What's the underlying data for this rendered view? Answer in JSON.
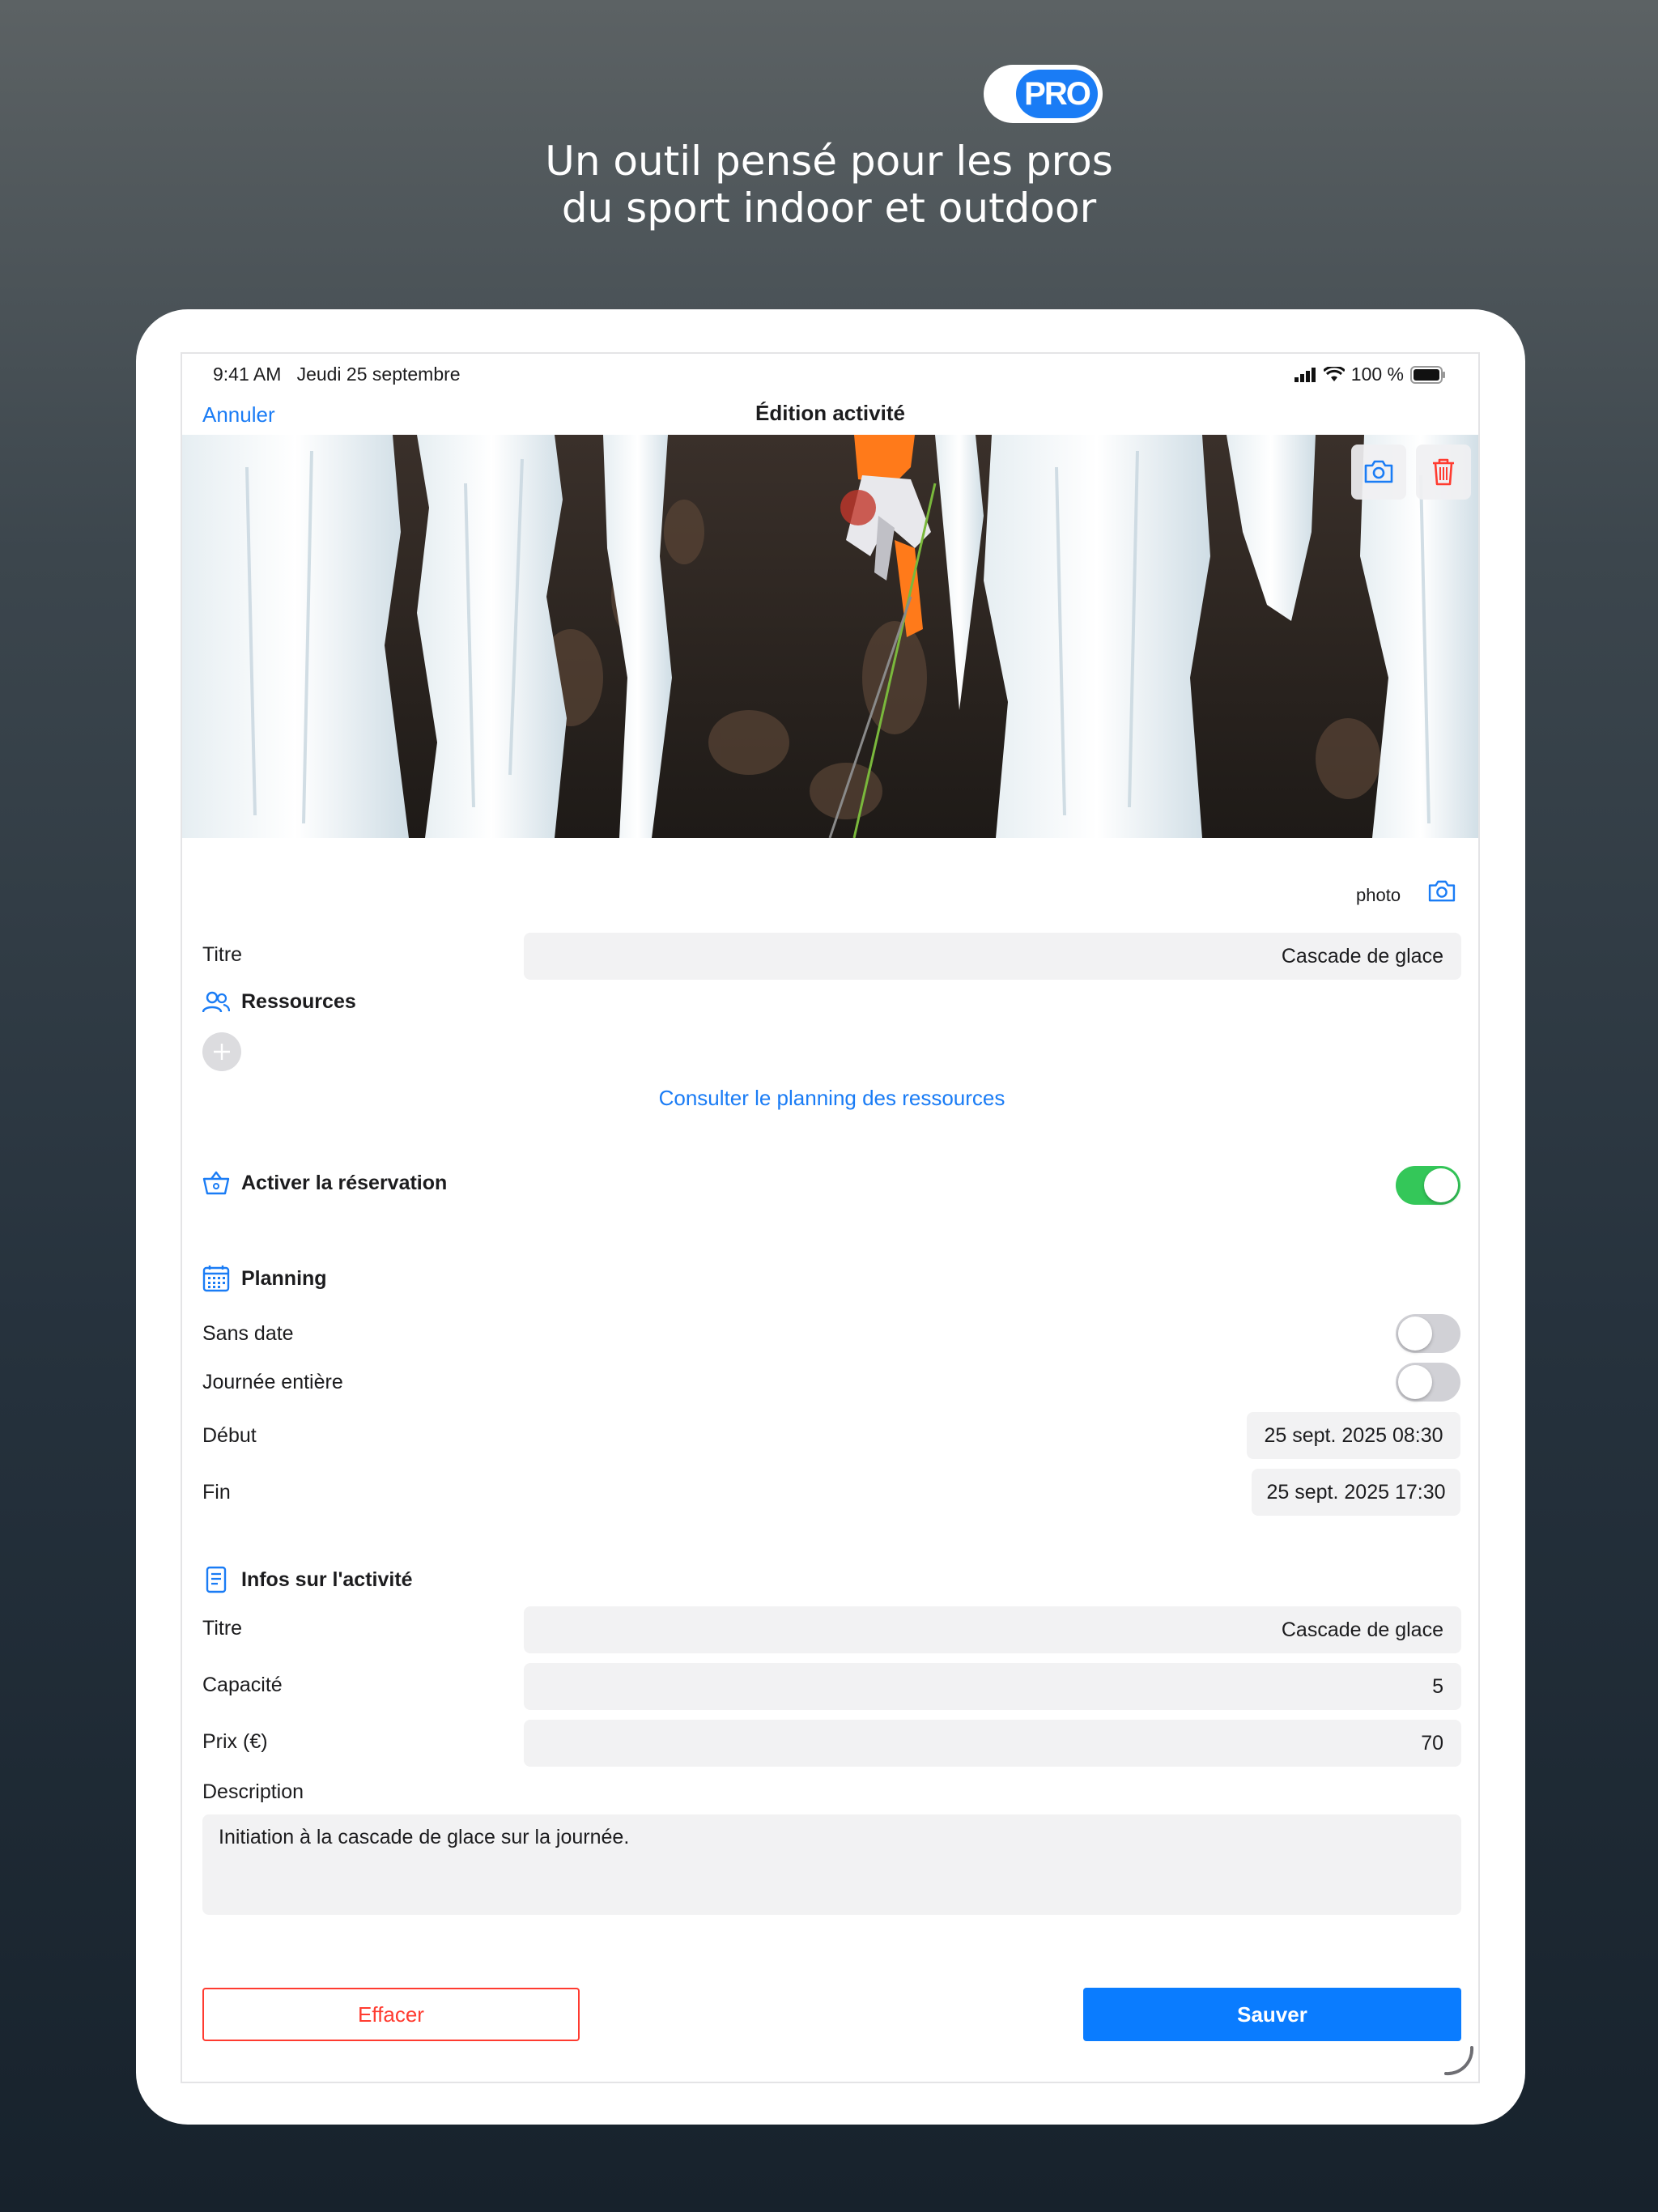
{
  "promo": {
    "badge": "PRO",
    "headline_1": "Un outil pensé pour les pros",
    "headline_2": "du sport indoor et outdoor"
  },
  "status": {
    "time": "9:41 AM",
    "date": "Jeudi 25 septembre",
    "battery": "100 %"
  },
  "nav": {
    "cancel": "Annuler",
    "title": "Édition activité"
  },
  "photo": {
    "label": "photo"
  },
  "form": {
    "titre_label": "Titre",
    "titre_value": "Cascade de glace",
    "ressources_heading": "Ressources",
    "planning_link": "Consulter le planning des ressources",
    "reservation_label": "Activer la réservation",
    "reservation_on": true
  },
  "planning": {
    "heading": "Planning",
    "sans_date_label": "Sans date",
    "journee_label": "Journée entière",
    "debut_label": "Début",
    "debut_value": "25 sept. 2025 08:30",
    "fin_label": "Fin",
    "fin_value": "25 sept. 2025 17:30"
  },
  "infos": {
    "heading": "Infos sur l'activité",
    "titre_label": "Titre",
    "titre_value": "Cascade de glace",
    "capacite_label": "Capacité",
    "capacite_value": "5",
    "prix_label": "Prix (€)",
    "prix_value": "70",
    "description_label": "Description",
    "description_value": "Initiation à la cascade de glace sur la journée."
  },
  "actions": {
    "clear": "Effacer",
    "save": "Sauver"
  },
  "colors": {
    "accent": "#1a7cf5",
    "danger": "#ff3b30",
    "toggle_on": "#34c759"
  }
}
